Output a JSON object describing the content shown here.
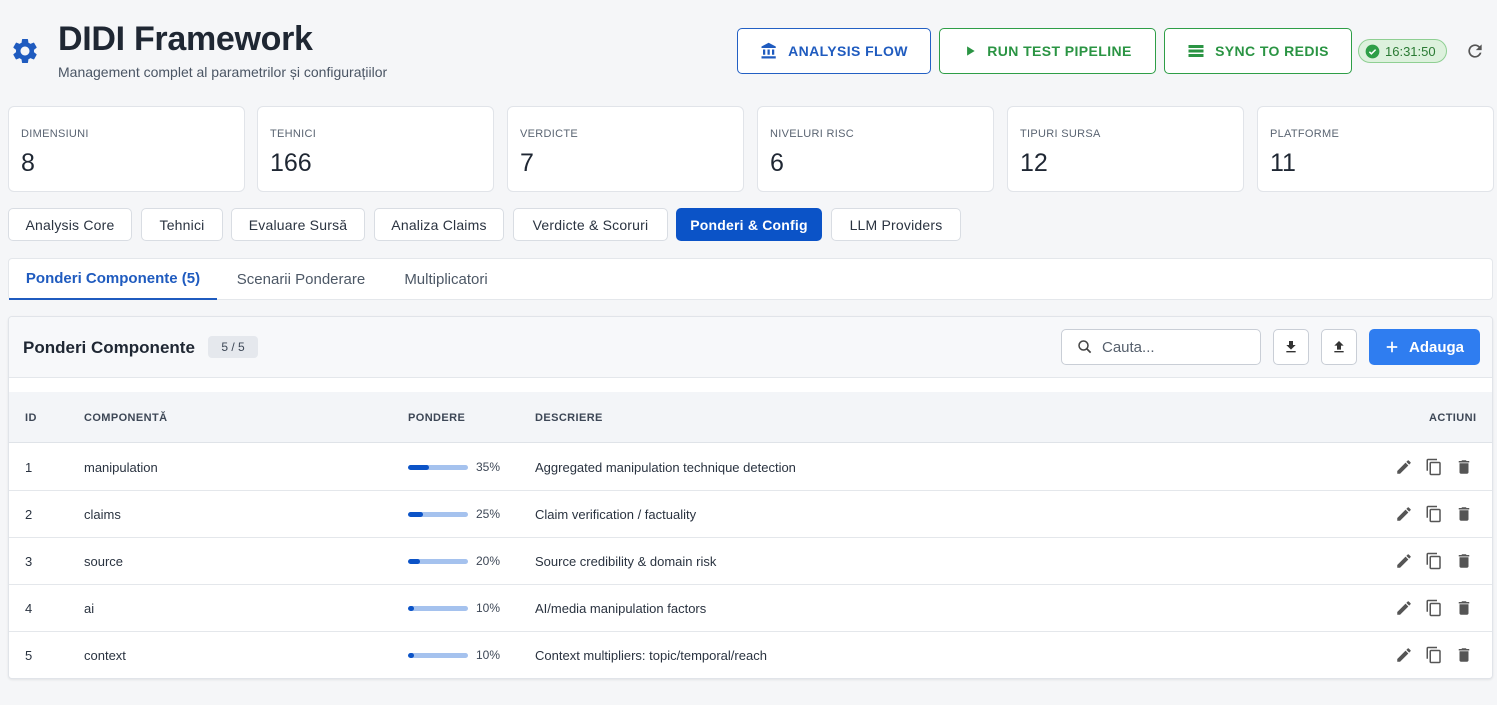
{
  "header": {
    "title": "DIDI Framework",
    "subtitle": "Management complet al parametrilor și configurațiilor",
    "buttons": {
      "analysis_flow": "ANALYSIS FLOW",
      "run_test": "RUN TEST PIPELINE",
      "sync_redis": "SYNC TO REDIS"
    },
    "clock": "16:31:50"
  },
  "stats": [
    {
      "label": "DIMENSIUNI",
      "value": "8"
    },
    {
      "label": "TEHNICI",
      "value": "166"
    },
    {
      "label": "VERDICTE",
      "value": "7"
    },
    {
      "label": "NIVELURI RISC",
      "value": "6"
    },
    {
      "label": "TIPURI SURSA",
      "value": "12"
    },
    {
      "label": "PLATFORME",
      "value": "11"
    }
  ],
  "main_tabs": [
    {
      "label": "Analysis Core"
    },
    {
      "label": "Tehnici"
    },
    {
      "label": "Evaluare Sursă"
    },
    {
      "label": "Analiza Claims"
    },
    {
      "label": "Verdicte & Scoruri"
    },
    {
      "label": "Ponderi & Config",
      "active": true
    },
    {
      "label": "LLM Providers"
    }
  ],
  "sub_tabs": [
    {
      "label": "Ponderi Componente (5)",
      "active": true
    },
    {
      "label": "Scenarii Ponderare"
    },
    {
      "label": "Multiplicatori"
    }
  ],
  "panel": {
    "title": "Ponderi Componente",
    "count": "5 / 5",
    "search_placeholder": "Cauta...",
    "add_label": "Adauga"
  },
  "table": {
    "columns": {
      "id": "ID",
      "component": "COMPONENTĂ",
      "weight": "PONDERE",
      "description": "DESCRIERE",
      "actions": "ACTIUNI"
    },
    "rows": [
      {
        "id": "1",
        "component": "manipulation",
        "weight": 35,
        "weight_label": "35%",
        "description": "Aggregated manipulation technique detection"
      },
      {
        "id": "2",
        "component": "claims",
        "weight": 25,
        "weight_label": "25%",
        "description": "Claim verification / factuality"
      },
      {
        "id": "3",
        "component": "source",
        "weight": 20,
        "weight_label": "20%",
        "description": "Source credibility & domain risk"
      },
      {
        "id": "4",
        "component": "ai",
        "weight": 10,
        "weight_label": "10%",
        "description": "AI/media manipulation factors"
      },
      {
        "id": "5",
        "component": "context",
        "weight": 10,
        "weight_label": "10%",
        "description": "Context multipliers: topic/temporal/reach"
      }
    ]
  },
  "colors": {
    "primary": "#0b53c7",
    "success": "#2a9443",
    "add_button": "#2f7df0",
    "bar_track": "#a5c2ee"
  }
}
